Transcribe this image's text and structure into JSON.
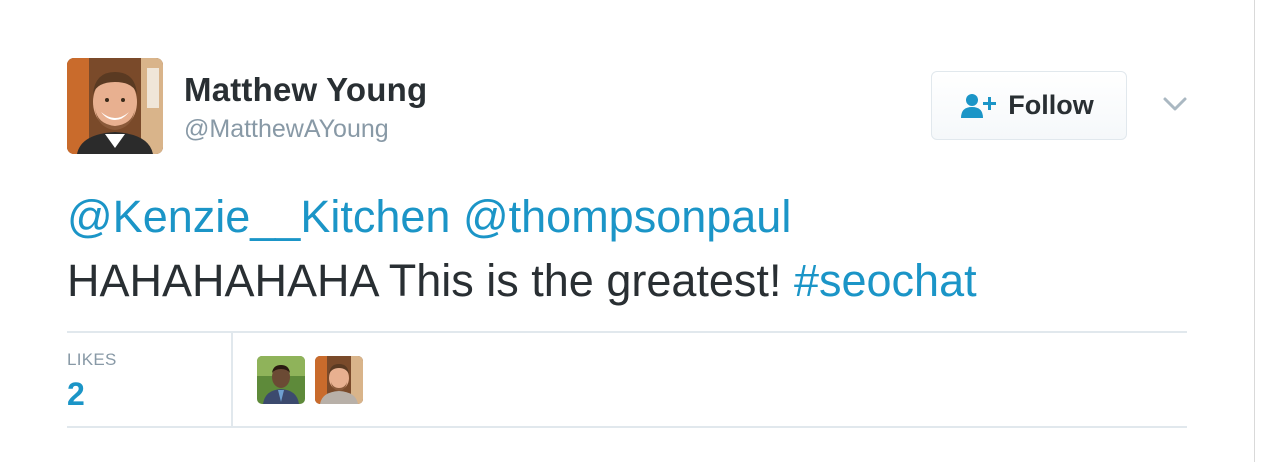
{
  "tweet": {
    "author": {
      "name": "Matthew Young",
      "handle": "@MatthewAYoung",
      "avatar_icon": "profile-photo"
    },
    "follow_button": {
      "label": "Follow",
      "icon": "add-user-icon"
    },
    "menu_icon": "chevron-down-icon",
    "mentions": [
      "@Kenzie__Kitchen",
      "@thompsonpaul"
    ],
    "text": "HAHAHAHAHA This is the greatest!",
    "hashtag": "#seochat",
    "stats": {
      "likes_label": "LIKES",
      "likes_count": "2"
    }
  },
  "colors": {
    "link": "#1b95c7",
    "text": "#292f33",
    "muted": "#8899a6",
    "divider": "#e1e8ed"
  }
}
